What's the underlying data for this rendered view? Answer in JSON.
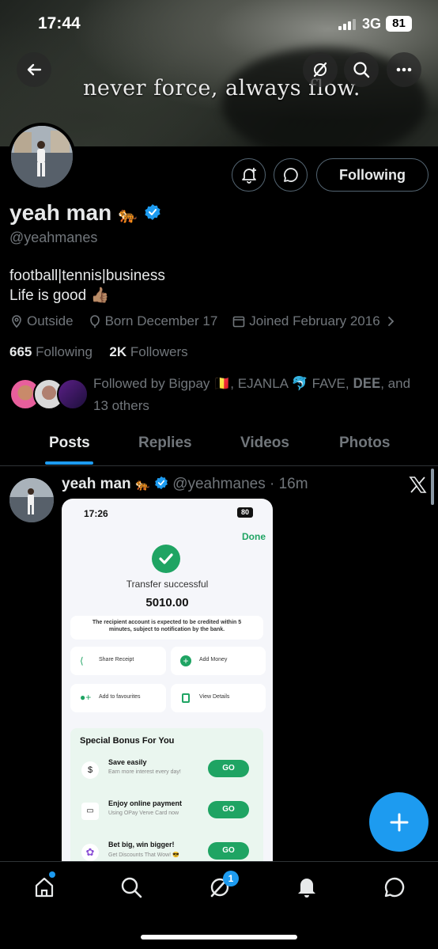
{
  "status_bar": {
    "time": "17:44",
    "network": "3G",
    "battery": "81"
  },
  "banner": {
    "quote": "never force, always flow."
  },
  "profile": {
    "name": "yeah man",
    "name_emoji": "🐅",
    "handle": "@yeahmanes",
    "bio_line1": "football|tennis|business",
    "bio_line2": "Life is good 👍🏽",
    "location": "Outside",
    "birthday": "Born December 17",
    "joined": "Joined February 2016",
    "following_count": "665",
    "following_label": "Following",
    "followers_count": "2K",
    "followers_label": "Followers",
    "followed_by": "Followed by Bigpay 🇧🇪, EJANLA 🐬 FAVE, 𝐃𝐄𝐄, and 13 others",
    "follow_button": "Following"
  },
  "tabs": [
    "Posts",
    "Replies",
    "Videos",
    "Photos"
  ],
  "post": {
    "name": "yeah man",
    "name_emoji": "🐅",
    "handle": "@yeahmanes",
    "time": "· 16m",
    "image": {
      "time": "17:26",
      "battery": "80",
      "done": "Done",
      "title": "Transfer successful",
      "amount": "5010.00",
      "notice": "The recipient account is expected to be credited within 5 minutes, subject to notification by the bank.",
      "actions": [
        "Share Receipt",
        "Add Money",
        "Add to favourites",
        "View Details"
      ],
      "bonus_title": "Special Bonus For You",
      "bonus_items": [
        {
          "title": "Save easily",
          "sub": "Earn more interest every day!",
          "btn": "GO"
        },
        {
          "title": "Enjoy online payment",
          "sub": "Using OPay Verve Card now",
          "btn": "GO"
        },
        {
          "title": "Bet big, win bigger!",
          "sub": "Get Discounts That Wow! 😎",
          "btn": "GO"
        }
      ]
    }
  },
  "nav": {
    "messages_badge": "1"
  },
  "colors": {
    "accent": "#1d9bf0",
    "background": "#000000",
    "muted": "#71767b",
    "success": "#1fa463"
  }
}
